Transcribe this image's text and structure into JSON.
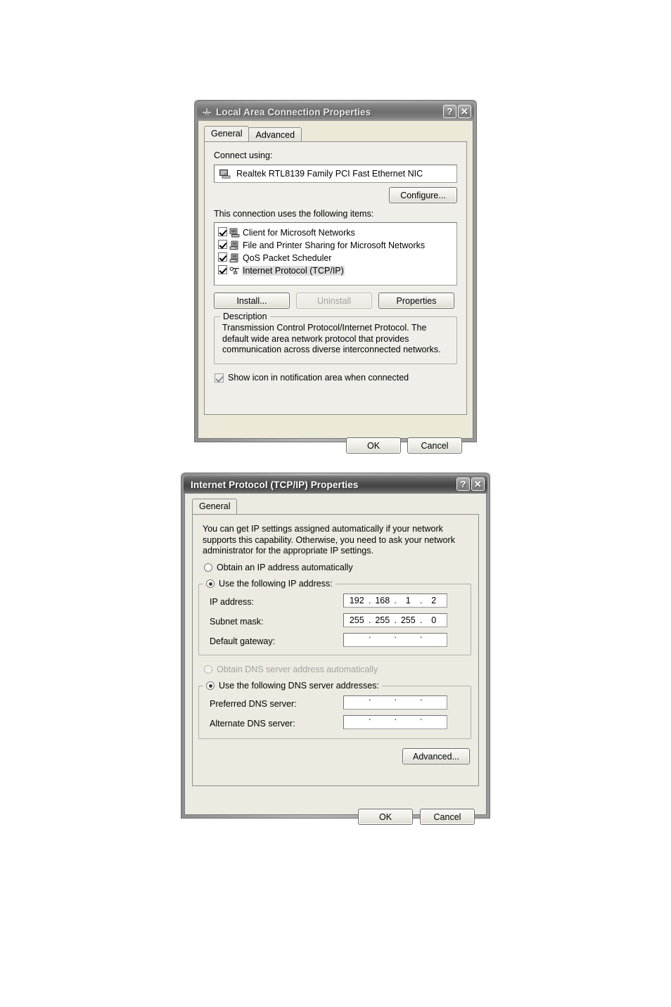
{
  "lan_dialog": {
    "title": "Local Area Connection Properties",
    "icon": "network-connection-icon",
    "titlebar_buttons": [
      {
        "name": "help-button",
        "glyph": "?"
      },
      {
        "name": "close-button",
        "glyph": "✕"
      }
    ],
    "tabs": [
      {
        "label": "General",
        "active": true
      },
      {
        "label": "Advanced",
        "active": false
      }
    ],
    "connect_using_label": "Connect using:",
    "adapter": {
      "name": "Realtek RTL8139 Family PCI Fast Ethernet NIC",
      "icon": "network-adapter-icon"
    },
    "configure_button": "Configure...",
    "items_label": "This connection uses the following items:",
    "items": [
      {
        "label": "Client for Microsoft Networks",
        "checked": true,
        "selected": false,
        "icon": "client-service-icon"
      },
      {
        "label": "File and Printer Sharing for Microsoft Networks",
        "checked": true,
        "selected": false,
        "icon": "file-sharing-icon"
      },
      {
        "label": "QoS Packet Scheduler",
        "checked": true,
        "selected": false,
        "icon": "qos-service-icon"
      },
      {
        "label": "Internet Protocol (TCP/IP)",
        "checked": true,
        "selected": true,
        "icon": "protocol-icon"
      }
    ],
    "install_button": "Install...",
    "uninstall_button": "Uninstall",
    "properties_button": "Properties",
    "description_group_title": "Description",
    "description_text": "Transmission Control Protocol/Internet Protocol. The default wide area network protocol that provides communication across diverse interconnected networks.",
    "show_icon_checkbox": {
      "label": "Show icon in notification area when connected",
      "checked": true
    },
    "ok_button": "OK",
    "cancel_button": "Cancel"
  },
  "tcpip_dialog": {
    "title": "Internet Protocol (TCP/IP) Properties",
    "titlebar_buttons": [
      {
        "name": "help-button",
        "glyph": "?"
      },
      {
        "name": "close-button",
        "glyph": "✕"
      }
    ],
    "tabs": [
      {
        "label": "General",
        "active": true
      }
    ],
    "intro_text": "You can get IP settings assigned automatically if your network supports this capability. Otherwise, you need to ask your network administrator for the appropriate IP settings.",
    "ip_mode": {
      "auto_label": "Obtain an IP address automatically",
      "auto_selected": false,
      "manual_label": "Use the following IP address:",
      "manual_selected": true
    },
    "ip_fields": [
      {
        "label": "IP address:",
        "octets": [
          "192",
          "168",
          "1",
          "2"
        ]
      },
      {
        "label": "Subnet mask:",
        "octets": [
          "255",
          "255",
          "255",
          "0"
        ]
      },
      {
        "label": "Default gateway:",
        "octets": [
          "",
          "",
          "",
          ""
        ]
      }
    ],
    "dns_mode": {
      "auto_label": "Obtain DNS server address automatically",
      "auto_selected": false,
      "auto_disabled": true,
      "manual_label": "Use the following DNS server addresses:",
      "manual_selected": true
    },
    "dns_fields": [
      {
        "label": "Preferred DNS server:",
        "octets": [
          "",
          "",
          "",
          ""
        ]
      },
      {
        "label": "Alternate DNS server:",
        "octets": [
          "",
          "",
          "",
          ""
        ]
      }
    ],
    "advanced_button": "Advanced...",
    "ok_button": "OK",
    "cancel_button": "Cancel"
  }
}
